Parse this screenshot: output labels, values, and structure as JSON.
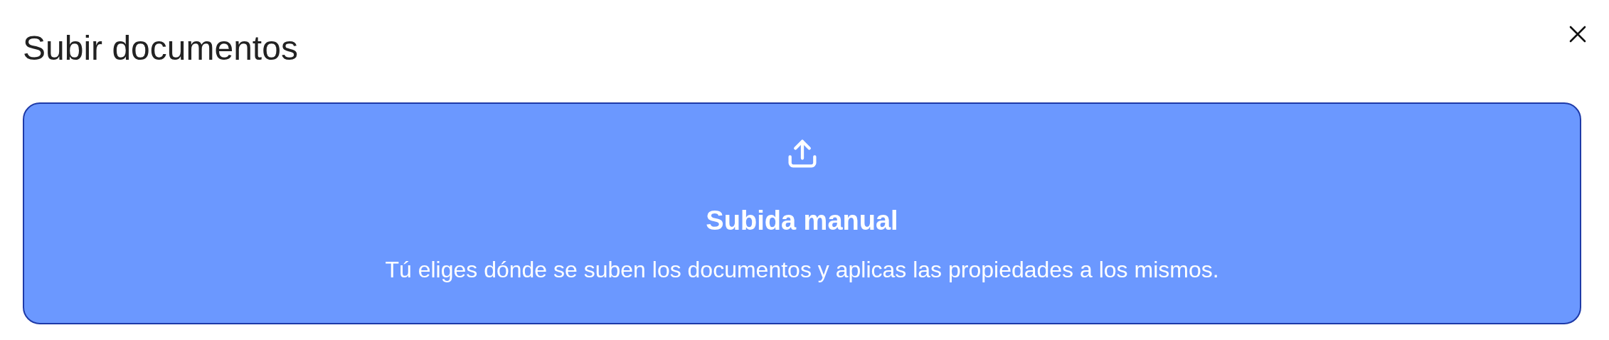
{
  "dialog": {
    "title": "Subir documentos"
  },
  "option": {
    "title": "Subida manual",
    "description": "Tú eliges dónde se suben los documentos y aplicas las propiedades a los mismos."
  }
}
